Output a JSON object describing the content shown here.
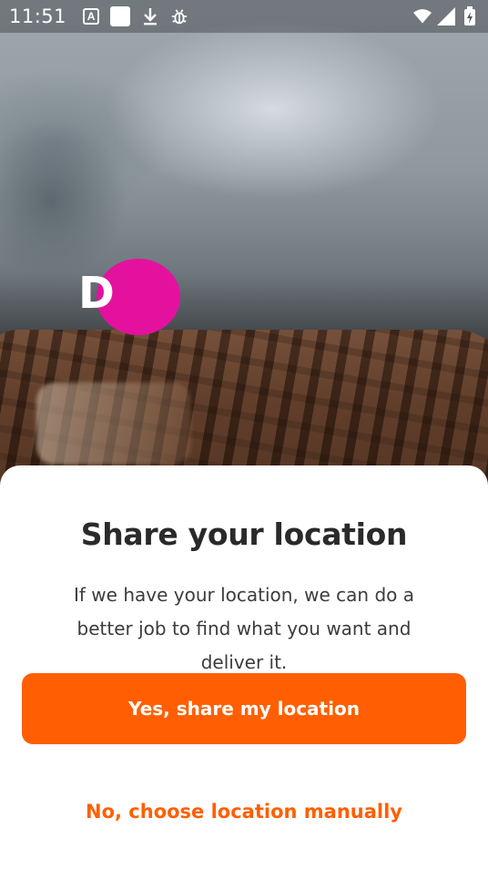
{
  "status_bar": {
    "time": "11:51",
    "left_icons": [
      "text-a-icon",
      "white-square-icon",
      "download-icon",
      "bug-icon"
    ],
    "right_icons": [
      "wifi-icon",
      "cell-signal-icon",
      "battery-charging-icon"
    ]
  },
  "hero": {
    "logo_letter": "D",
    "logo_color": "#e4119f"
  },
  "sheet": {
    "title": "Share your location",
    "description": "If we have your location, we can do a better job to find what you want and deliver it.",
    "primary_button": "Yes, share my location",
    "secondary_button": "No, choose location manually",
    "accent_color": "#ff5f02"
  }
}
